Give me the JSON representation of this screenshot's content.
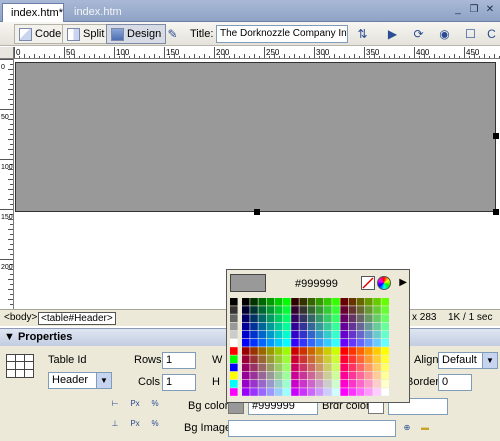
{
  "tabs": [
    {
      "label": "index.htm*",
      "active": true
    },
    {
      "label": "index.htm",
      "active": false
    }
  ],
  "window_buttons": [
    "minimize-icon",
    "restore-icon",
    "close-icon"
  ],
  "toolbar": {
    "code_label": "Code",
    "split_label": "Split",
    "design_label": "Design",
    "title_label": "Title:",
    "title_value": "The Dorknozzle Company Intra"
  },
  "ruler": {
    "h_ticks": [
      "0",
      "50",
      "100",
      "150",
      "200",
      "250",
      "300",
      "350",
      "400",
      "450"
    ],
    "v_ticks": [
      "0",
      "50",
      "100",
      "150",
      "200"
    ]
  },
  "table_color": "#999999",
  "status": {
    "tag_body": "<body>",
    "tag_table": "<table#Header>",
    "size": "x 283",
    "weight": "1K / 1 sec"
  },
  "picker": {
    "hex": "#999999",
    "swatch_colors": {
      "left_column": [
        "#000000",
        "#333333",
        "#666666",
        "#999999",
        "#cccccc",
        "#ffffff",
        "#ff0000",
        "#00ff00",
        "#0000ff",
        "#ffff00",
        "#00ffff",
        "#ff00ff"
      ]
    }
  },
  "properties": {
    "header": "Properties",
    "table_id_label": "Table Id",
    "table_id_value": "Header",
    "rows_label": "Rows",
    "rows_value": "1",
    "cols_label": "Cols",
    "cols_value": "1",
    "w_label": "W",
    "h_label": "H",
    "align_label": "Align",
    "align_value": "Default",
    "border_label": "Border",
    "border_value": "0",
    "bgcolor_label": "Bg color",
    "bgcolor_value": "#999999",
    "brdr_label": "Brdr color",
    "brdr_value": "",
    "bgimage_label": "Bg Image",
    "bgimage_value": ""
  }
}
